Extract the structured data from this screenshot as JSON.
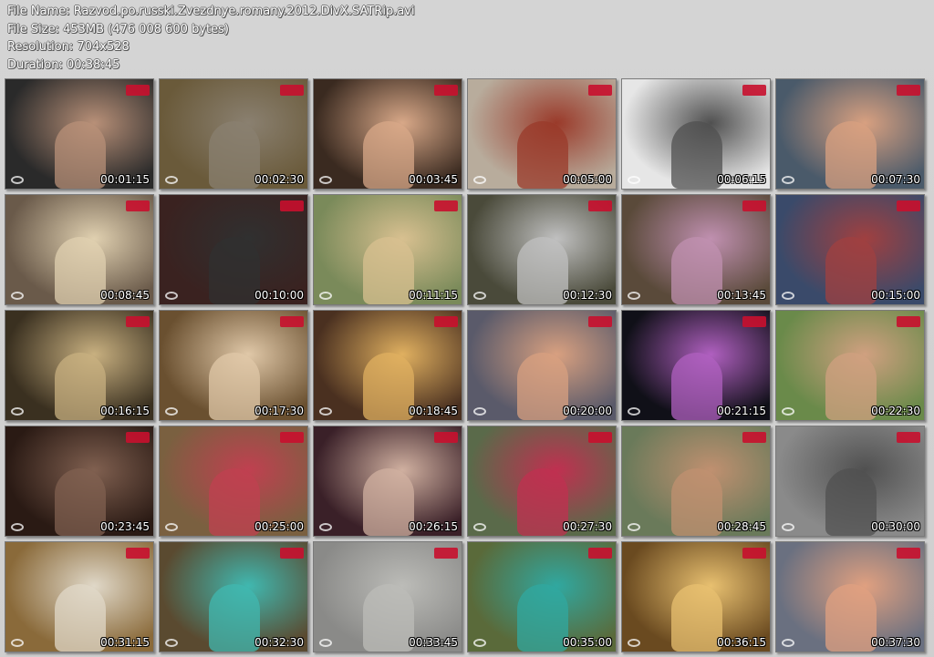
{
  "header": {
    "file_name": "File Name: Razvod.po.russki.Zvezdnye.romany.2012.DivX.SATRip.avi",
    "file_size": "File Size: 453MB (476 008 600 bytes)",
    "resolution": "Resolution: 704x528",
    "duration": "Duration: 00:38:45"
  },
  "thumbnails": [
    {
      "timestamp": "00:01:15",
      "bg": "#2a2a2a",
      "accent": "#b89078"
    },
    {
      "timestamp": "00:02:30",
      "bg": "#6a5a3a",
      "accent": "#8a8070"
    },
    {
      "timestamp": "00:03:45",
      "bg": "#3a2a20",
      "accent": "#d8a888"
    },
    {
      "timestamp": "00:05:00",
      "bg": "#b8ac9c",
      "accent": "#9a3a2a"
    },
    {
      "timestamp": "00:06:15",
      "bg": "#e6e6e6",
      "accent": "#505050"
    },
    {
      "timestamp": "00:07:30",
      "bg": "#4a5a6a",
      "accent": "#d8a080"
    },
    {
      "timestamp": "00:08:45",
      "bg": "#6a5a4a",
      "accent": "#e0d0b0"
    },
    {
      "timestamp": "00:10:00",
      "bg": "#3a2220",
      "accent": "#303030"
    },
    {
      "timestamp": "00:11:15",
      "bg": "#7a8a5a",
      "accent": "#d8c090"
    },
    {
      "timestamp": "00:12:30",
      "bg": "#4a4a3a",
      "accent": "#c0c0c0"
    },
    {
      "timestamp": "00:13:45",
      "bg": "#5a4a3a",
      "accent": "#c090b0"
    },
    {
      "timestamp": "00:15:00",
      "bg": "#3a4a6a",
      "accent": "#a04040"
    },
    {
      "timestamp": "00:16:15",
      "bg": "#3a3020",
      "accent": "#c8b080"
    },
    {
      "timestamp": "00:17:30",
      "bg": "#6a5030",
      "accent": "#e0c8a8"
    },
    {
      "timestamp": "00:18:45",
      "bg": "#4a3020",
      "accent": "#e0b060"
    },
    {
      "timestamp": "00:20:00",
      "bg": "#5a5a6a",
      "accent": "#d8a080"
    },
    {
      "timestamp": "00:21:15",
      "bg": "#101018",
      "accent": "#b060c0"
    },
    {
      "timestamp": "00:22:30",
      "bg": "#6a8a4a",
      "accent": "#d0a080"
    },
    {
      "timestamp": "00:23:45",
      "bg": "#2a1a14",
      "accent": "#806050"
    },
    {
      "timestamp": "00:25:00",
      "bg": "#7a6040",
      "accent": "#c04050"
    },
    {
      "timestamp": "00:26:15",
      "bg": "#3a2028",
      "accent": "#d0b0a0"
    },
    {
      "timestamp": "00:27:30",
      "bg": "#5a6a4a",
      "accent": "#c03050"
    },
    {
      "timestamp": "00:28:45",
      "bg": "#6a7a5a",
      "accent": "#c09070"
    },
    {
      "timestamp": "00:30:00",
      "bg": "#8a8a8a",
      "accent": "#505050"
    },
    {
      "timestamp": "00:31:15",
      "bg": "#8a6a3a",
      "accent": "#e0d8c8"
    },
    {
      "timestamp": "00:32:30",
      "bg": "#5a4a30",
      "accent": "#40b8b0"
    },
    {
      "timestamp": "00:33:45",
      "bg": "#8a8a88",
      "accent": "#bcbcb8"
    },
    {
      "timestamp": "00:35:00",
      "bg": "#5a6a3a",
      "accent": "#30a8a0"
    },
    {
      "timestamp": "00:36:15",
      "bg": "#6a4a20",
      "accent": "#e8c070"
    },
    {
      "timestamp": "00:37:30",
      "bg": "#6a7080",
      "accent": "#e0a080"
    }
  ]
}
